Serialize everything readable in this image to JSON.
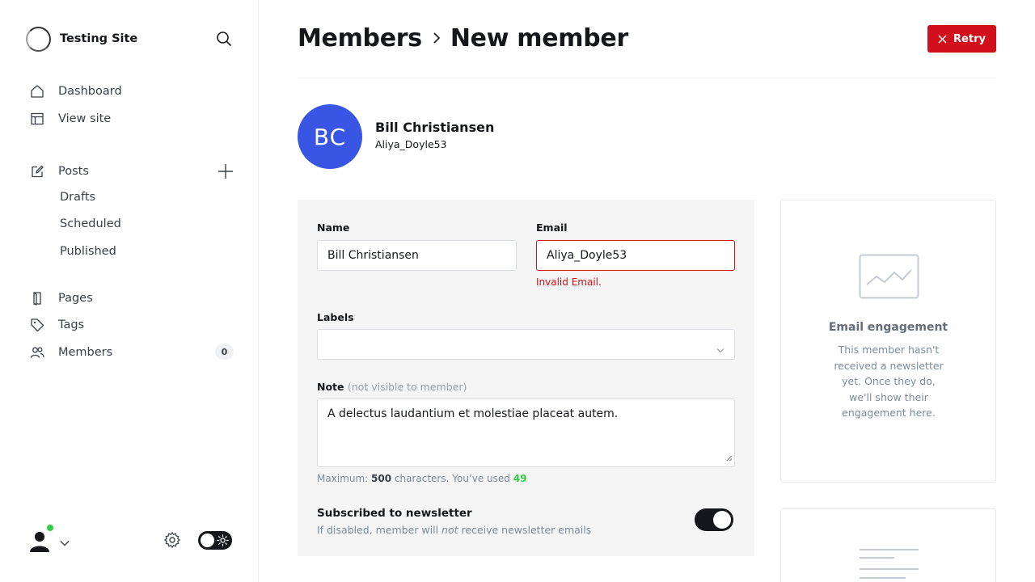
{
  "sidebar": {
    "site_title": "Testing Site",
    "nav": {
      "dashboard": "Dashboard",
      "view_site": "View site",
      "posts": "Posts",
      "drafts": "Drafts",
      "scheduled": "Scheduled",
      "published": "Published",
      "pages": "Pages",
      "tags": "Tags",
      "members": "Members",
      "members_count": "0"
    }
  },
  "header": {
    "breadcrumb_parent": "Members",
    "breadcrumb_current": "New member",
    "retry_label": "Retry"
  },
  "member": {
    "initials": "BC",
    "name": "Bill Christiansen",
    "email_display": "Aliya_Doyle53",
    "avatar_color": "#3955e3"
  },
  "form": {
    "name_label": "Name",
    "name_value": "Bill Christiansen",
    "email_label": "Email",
    "email_value": "Aliya_Doyle53",
    "email_error": "Invalid Email.",
    "labels_label": "Labels",
    "note_label": "Note",
    "note_hint": "(not visible to member)",
    "note_value": "A delectus laudantium et molestiae placeat autem.",
    "counter_prefix": "Maximum:",
    "counter_max": "500",
    "counter_mid": "characters. You’ve used",
    "counter_used": "49",
    "newsletter_title": "Subscribed to newsletter",
    "newsletter_desc_pre": "If disabled, member will",
    "newsletter_desc_em": "not",
    "newsletter_desc_post": "receive newsletter emails",
    "newsletter_subscribed": true
  },
  "engagement_card": {
    "title": "Email engagement",
    "text": "This member hasn't received a newsletter yet. Once they do, we'll show their engagement here."
  },
  "colors": {
    "accent_red": "#d2101b",
    "success_green": "#30cf43",
    "dark": "#15171a"
  }
}
